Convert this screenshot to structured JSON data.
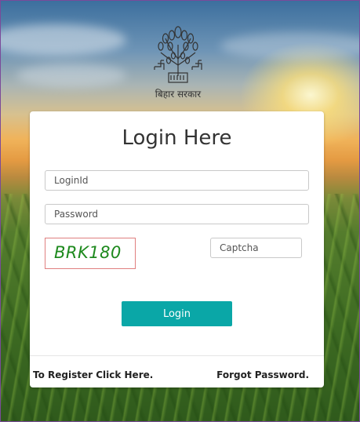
{
  "logo": {
    "caption": "बिहार सरकार"
  },
  "login": {
    "title": "Login Here",
    "loginid_placeholder": "LoginId",
    "password_placeholder": "Password",
    "captcha_code": "BRK180",
    "captcha_placeholder": "Captcha",
    "button_label": "Login",
    "register_link": "To Register Click Here.",
    "forgot_link": "Forgot Password."
  },
  "colors": {
    "button": "#0aa7a7",
    "captcha_text": "#1e8a1e",
    "captcha_border": "#e08080"
  }
}
